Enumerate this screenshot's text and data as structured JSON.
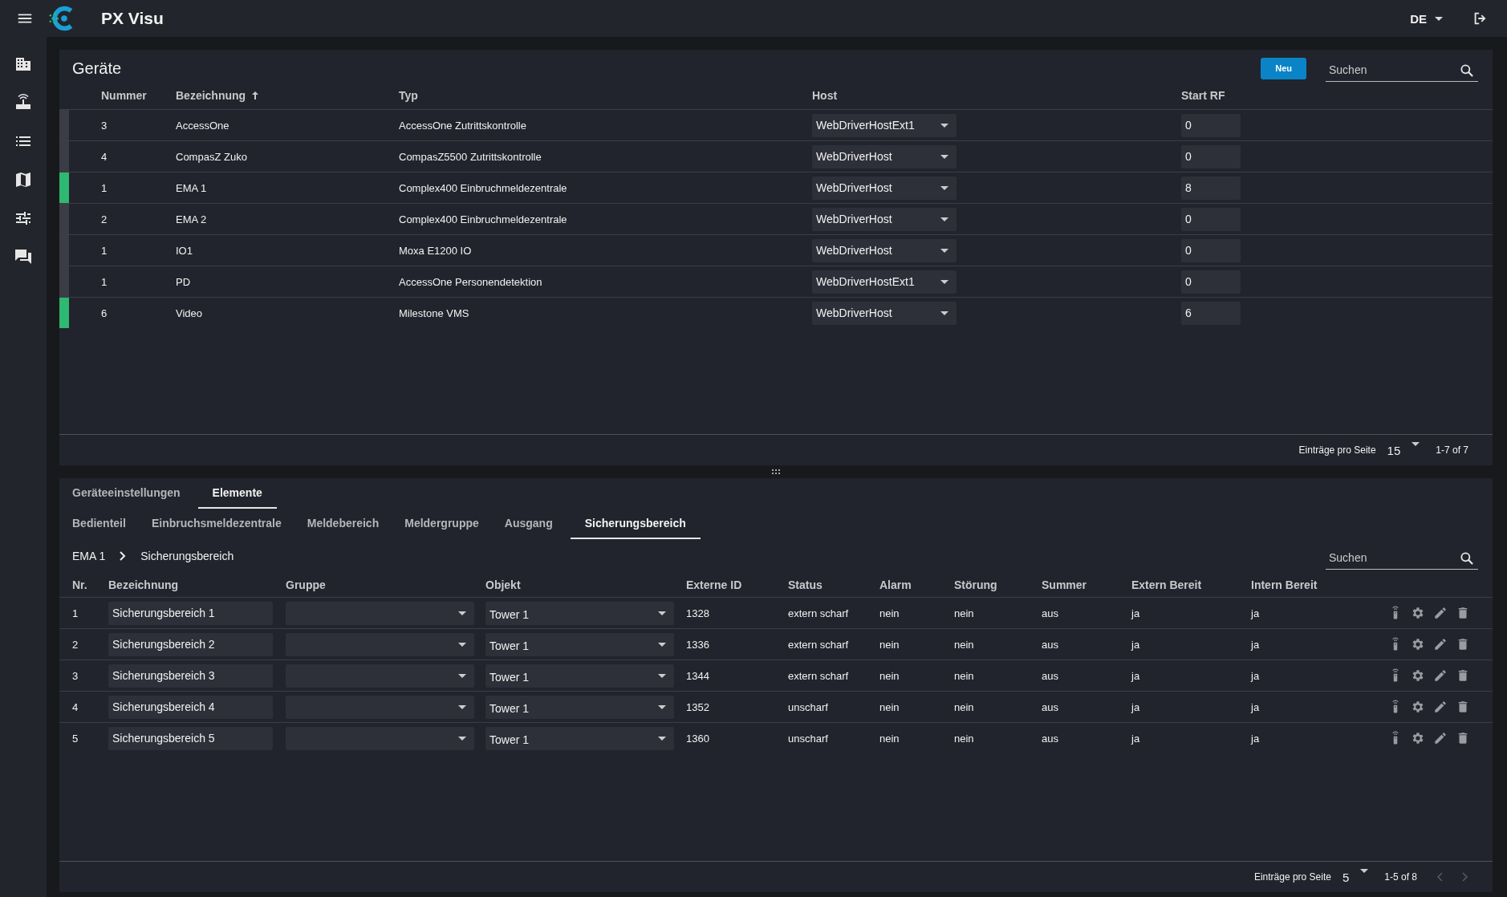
{
  "app_bar": {
    "title": "PX Visu",
    "language": "DE"
  },
  "devices": {
    "title": "Geräte",
    "new_button": "Neu",
    "search": {
      "placeholder": "Suchen"
    },
    "columns": [
      {
        "label": "Nummer",
        "sorted": false
      },
      {
        "label": "Bezeichnung",
        "sorted": true
      },
      {
        "label": "Typ",
        "sorted": false
      },
      {
        "label": "Host",
        "sorted": false
      },
      {
        "label": "Start RF",
        "sorted": false
      }
    ],
    "rows": [
      {
        "color": "#3a3d46",
        "number": "3",
        "name": "AccessOne",
        "type": "AccessOne Zutrittskontrolle",
        "host": "WebDriverHostExt1",
        "start_rf": "0"
      },
      {
        "color": "#3a3d46",
        "number": "4",
        "name": "CompasZ Zuko",
        "type": "CompasZ5500 Zutrittskontrolle",
        "host": "WebDriverHost",
        "start_rf": "0"
      },
      {
        "color": "#2eb872",
        "number": "1",
        "name": "EMA 1",
        "type": "Complex400 Einbruchmeldezentrale",
        "host": "WebDriverHost",
        "start_rf": "8"
      },
      {
        "color": "#3a3d46",
        "number": "2",
        "name": "EMA 2",
        "type": "Complex400 Einbruchmeldezentrale",
        "host": "WebDriverHost",
        "start_rf": "0"
      },
      {
        "color": "#3a3d46",
        "number": "1",
        "name": "IO1",
        "type": "Moxa E1200 IO",
        "host": "WebDriverHost",
        "start_rf": "0"
      },
      {
        "color": "#3a3d46",
        "number": "1",
        "name": "PD",
        "type": "AccessOne Personendetektion",
        "host": "WebDriverHostExt1",
        "start_rf": "0"
      },
      {
        "color": "#2eb872",
        "number": "6",
        "name": "Video",
        "type": "Milestone VMS",
        "host": "WebDriverHost",
        "start_rf": "6"
      }
    ],
    "footer": {
      "per_page_label": "Einträge pro Seite",
      "per_page": "15",
      "range": "1-7 of 7"
    }
  },
  "details": {
    "tabs": [
      {
        "label": "Geräteeinstellungen",
        "selected": false
      },
      {
        "label": "Elemente",
        "selected": true
      }
    ],
    "subtabs": [
      {
        "label": "Bedienteil",
        "selected": false
      },
      {
        "label": "Einbruchsmeldezentrale",
        "selected": false
      },
      {
        "label": "Meldebereich",
        "selected": false
      },
      {
        "label": "Meldergruppe",
        "selected": false
      },
      {
        "label": "Ausgang",
        "selected": false
      },
      {
        "label": "Sicherungsbereich",
        "selected": true
      }
    ],
    "breadcrumb": [
      "EMA 1",
      "Sicherungsbereich"
    ],
    "search": {
      "placeholder": "Suchen"
    },
    "columns": [
      "Nr.",
      "Bezeichnung",
      "Gruppe",
      "Objekt",
      "Externe ID",
      "Status",
      "Alarm",
      "Störung",
      "Summer",
      "Extern Bereit",
      "Intern Bereit"
    ],
    "rows": [
      {
        "nr": "1",
        "name": "Sicherungsbereich 1",
        "object": "Tower 1",
        "external_id": "1328",
        "status": "extern scharf",
        "alarm": "nein",
        "stoerung": "nein",
        "summer": "aus",
        "extern_bereit": "ja",
        "intern_bereit": "ja"
      },
      {
        "nr": "2",
        "name": "Sicherungsbereich 2",
        "object": "Tower 1",
        "external_id": "1336",
        "status": "extern scharf",
        "alarm": "nein",
        "stoerung": "nein",
        "summer": "aus",
        "extern_bereit": "ja",
        "intern_bereit": "ja"
      },
      {
        "nr": "3",
        "name": "Sicherungsbereich 3",
        "object": "Tower 1",
        "external_id": "1344",
        "status": "extern scharf",
        "alarm": "nein",
        "stoerung": "nein",
        "summer": "aus",
        "extern_bereit": "ja",
        "intern_bereit": "ja"
      },
      {
        "nr": "4",
        "name": "Sicherungsbereich 4",
        "object": "Tower 1",
        "external_id": "1352",
        "status": "unscharf",
        "alarm": "nein",
        "stoerung": "nein",
        "summer": "aus",
        "extern_bereit": "ja",
        "intern_bereit": "ja"
      },
      {
        "nr": "5",
        "name": "Sicherungsbereich 5",
        "object": "Tower 1",
        "external_id": "1360",
        "status": "unscharf",
        "alarm": "nein",
        "stoerung": "nein",
        "summer": "aus",
        "extern_bereit": "ja",
        "intern_bereit": "ja"
      }
    ],
    "footer": {
      "per_page_label": "Einträge pro Seite",
      "per_page": "5",
      "range": "1-5 of 8",
      "prev_disabled": true,
      "next_disabled": true
    }
  }
}
